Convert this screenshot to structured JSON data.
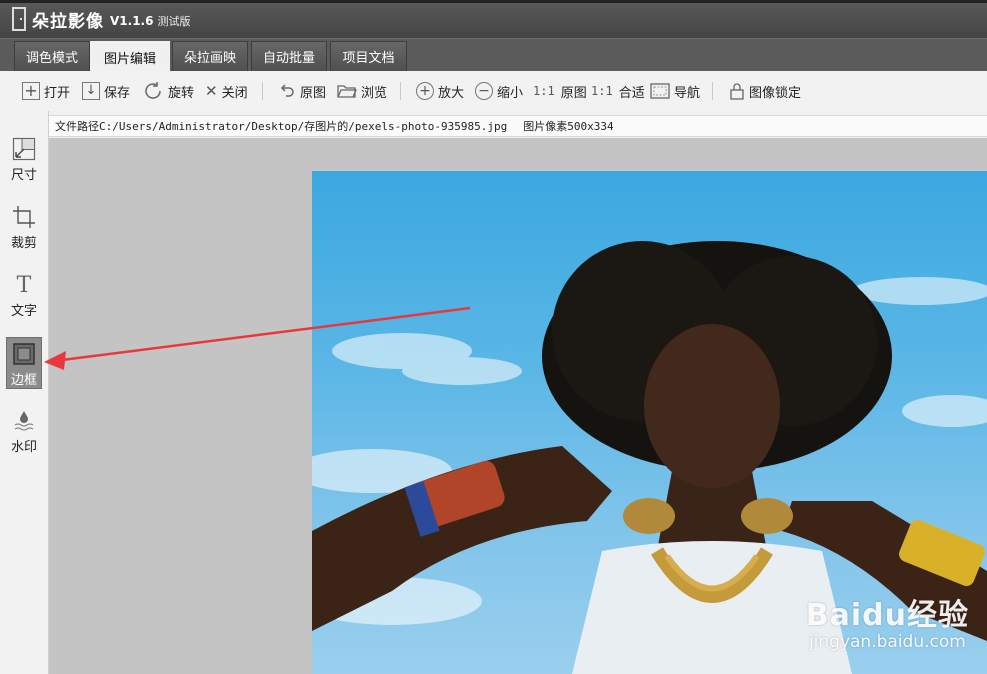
{
  "app": {
    "name": "朵拉影像",
    "version": "V1.1.6",
    "edition": "测试版"
  },
  "tabs": [
    {
      "label": "调色模式",
      "active": false
    },
    {
      "label": "图片编辑",
      "active": true
    },
    {
      "label": "朵拉画映",
      "active": false
    },
    {
      "label": "自动批量",
      "active": false
    },
    {
      "label": "项目文档",
      "active": false
    }
  ],
  "toolbar": {
    "open": "打开",
    "save": "保存",
    "rotate": "旋转",
    "close": "关闭",
    "original": "原图",
    "browse": "浏览",
    "zoom_in": "放大",
    "zoom_out": "缩小",
    "ratio_original_prefix": "1:1",
    "ratio_original": "原图",
    "ratio_fit_prefix": "1:1",
    "ratio_fit": "合适",
    "navigate": "导航",
    "lock": "图像锁定"
  },
  "left_tools": [
    {
      "label": "尺寸",
      "icon": "resize-icon",
      "active": false
    },
    {
      "label": "裁剪",
      "icon": "crop-icon",
      "active": false
    },
    {
      "label": "文字",
      "icon": "text-icon",
      "active": false
    },
    {
      "label": "边框",
      "icon": "border-icon",
      "active": true
    },
    {
      "label": "水印",
      "icon": "watermark-drop-icon",
      "active": false
    }
  ],
  "pathbar": {
    "path_label": "文件路径",
    "path_value": "C:/Users/Administrator/Desktop/存图片的/pexels-photo-935985.jpg",
    "pixels_label": "图片像素",
    "pixels_value": "500x334"
  },
  "watermark": {
    "brand": "Baidu经验",
    "url": "jingyan.baidu.com"
  },
  "colors": {
    "titlebar": "#4a4a4a",
    "tabbar": "#5b5b5b",
    "canvas": "#c4c4c4",
    "active_tool": "#8c8c8c",
    "annotation_arrow": "#e8383d"
  }
}
